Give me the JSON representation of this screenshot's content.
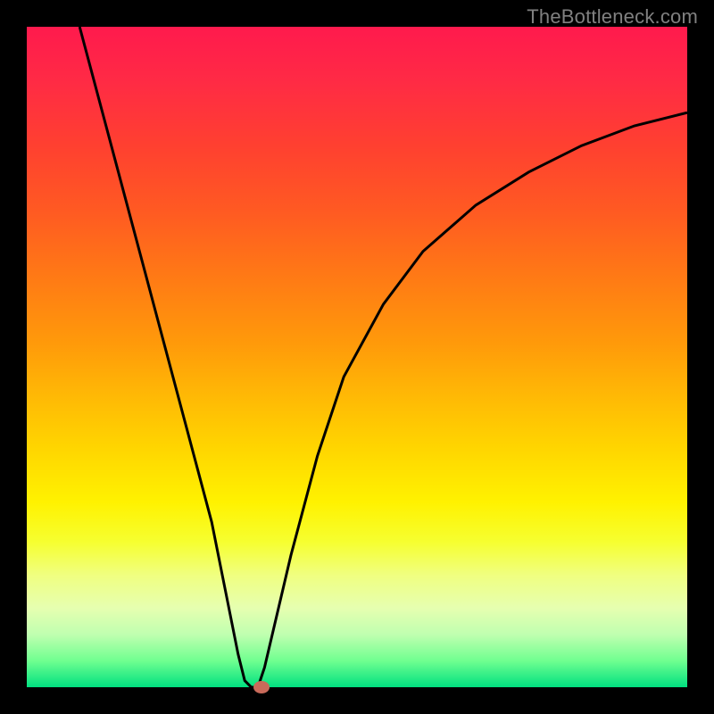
{
  "watermark": "TheBottleneck.com",
  "chart_data": {
    "type": "line",
    "title": "",
    "xlabel": "",
    "ylabel": "",
    "xlim": [
      0,
      100
    ],
    "ylim": [
      0,
      100
    ],
    "grid": false,
    "series": [
      {
        "name": "curve",
        "x": [
          8,
          12,
          16,
          20,
          24,
          28,
          30,
          32,
          33,
          34,
          35,
          36,
          40,
          44,
          48,
          54,
          60,
          68,
          76,
          84,
          92,
          100
        ],
        "y": [
          100,
          85,
          70,
          55,
          40,
          25,
          15,
          5,
          1,
          0,
          0,
          3,
          20,
          35,
          47,
          58,
          66,
          73,
          78,
          82,
          85,
          87
        ]
      }
    ],
    "marker": {
      "x": 35.5,
      "y": 0
    },
    "gradient_stops": [
      {
        "pct": 0,
        "color": "#ff1a4d"
      },
      {
        "pct": 50,
        "color": "#ffb000"
      },
      {
        "pct": 75,
        "color": "#fff200"
      },
      {
        "pct": 100,
        "color": "#00e080"
      }
    ]
  }
}
